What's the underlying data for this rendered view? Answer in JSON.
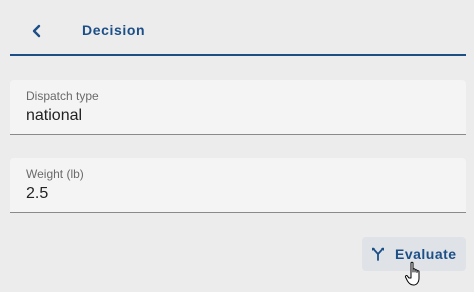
{
  "header": {
    "back_icon": "chevron-left-icon",
    "title": "Decision"
  },
  "fields": {
    "dispatch_type": {
      "label": "Dispatch type",
      "value": "national"
    },
    "weight": {
      "label": "Weight (lb)",
      "value": "2.5"
    }
  },
  "actions": {
    "evaluate": {
      "icon": "call-split-icon",
      "label": "Evaluate"
    }
  },
  "colors": {
    "accent": "#1d4f87",
    "background": "#ececec",
    "field_background": "#f4f4f4",
    "button_background": "#dfe3e8"
  },
  "cursor": {
    "icon": "hand-pointer-icon"
  }
}
